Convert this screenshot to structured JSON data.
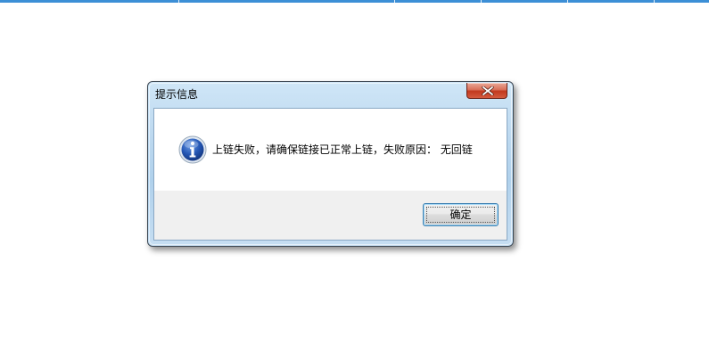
{
  "dialog": {
    "title": "提示信息",
    "message": "上链失败，请确保链接已正常上链，失败原因： 无回链",
    "ok_label": "确定",
    "icon": "info-icon",
    "close_icon": "close-icon"
  },
  "colors": {
    "top_strip": "#3c8fd6",
    "close_button": "#c2391e",
    "button_area": "#f0f0f0",
    "icon_blue": "#1f5cb8"
  }
}
